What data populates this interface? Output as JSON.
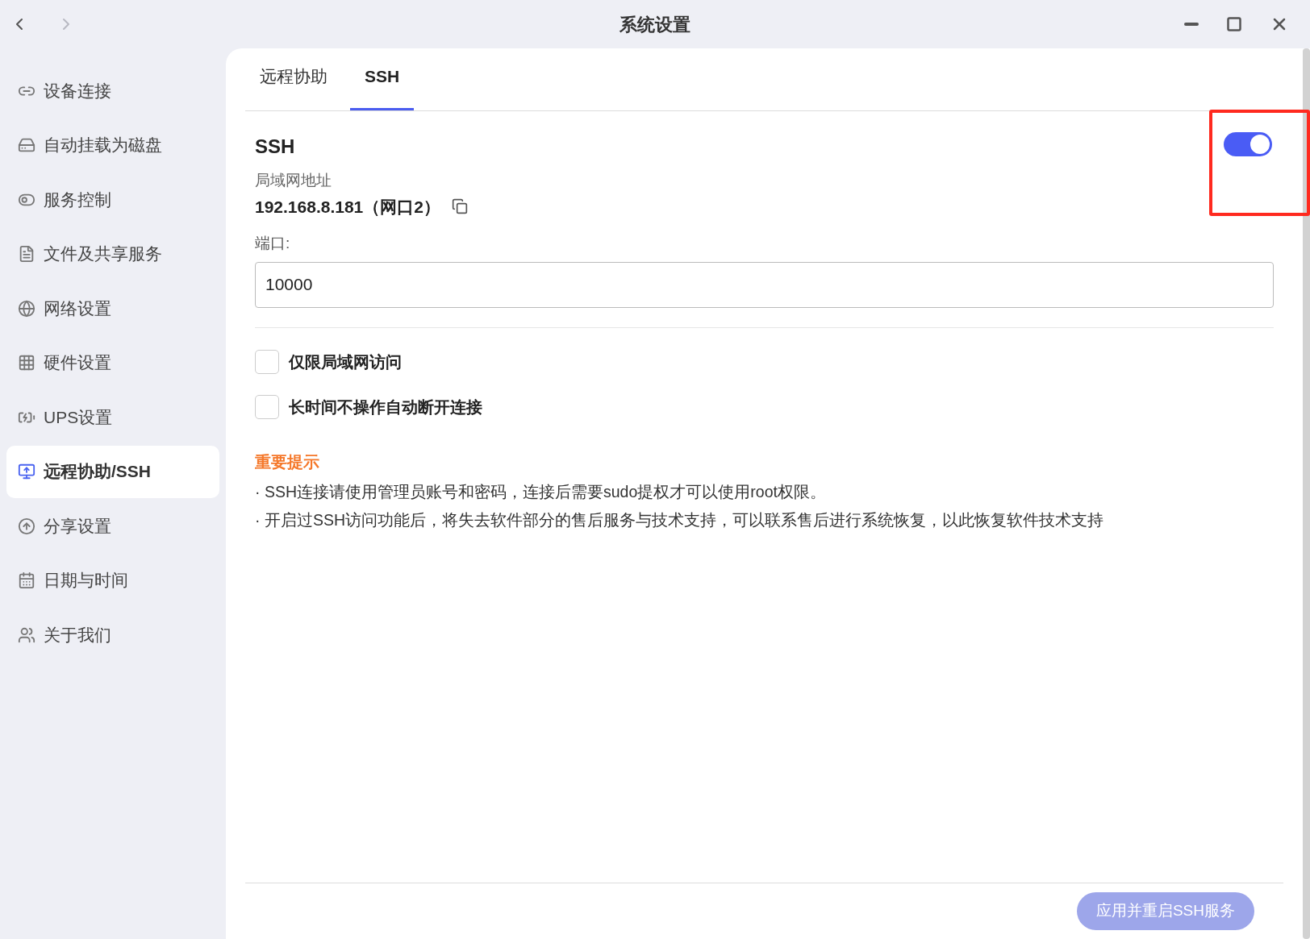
{
  "window": {
    "title": "系统设置",
    "nav": [
      {
        "kind": "back",
        "disabled": false
      },
      {
        "kind": "forward",
        "disabled": true
      }
    ]
  },
  "sidebar": {
    "items": [
      {
        "label": "设备连接",
        "selected": false
      },
      {
        "label": "自动挂载为磁盘",
        "selected": false
      },
      {
        "label": "服务控制",
        "selected": false
      },
      {
        "label": "文件及共享服务",
        "selected": false
      },
      {
        "label": "网络设置",
        "selected": false
      },
      {
        "label": "硬件设置",
        "selected": false
      },
      {
        "label": "UPS设置",
        "selected": false
      },
      {
        "label": "远程协助/SSH",
        "selected": true
      },
      {
        "label": "分享设置",
        "selected": false
      },
      {
        "label": "日期与时间",
        "selected": false
      },
      {
        "label": "关于我们",
        "selected": false
      }
    ]
  },
  "tabs": [
    {
      "label": "远程协助",
      "selected": false
    },
    {
      "label": "SSH",
      "selected": true
    }
  ],
  "ssh": {
    "title": "SSH",
    "on": true,
    "lan_label": "局域网地址",
    "lan_address": "192.168.8.181（网口2）",
    "port_label": "端口:",
    "port_value": "10000",
    "options": [
      {
        "label": "仅限局域网访问",
        "checked": false
      },
      {
        "label": "长时间不操作自动断开连接",
        "checked": false
      }
    ],
    "notice_title": "重要提示",
    "notices": [
      "· SSH连接请使用管理员账号和密码，连接后需要sudo提权才可以使用root权限。",
      "· 开启过SSH访问功能后，将失去软件部分的售后服务与技术支持，可以联系售后进行系统恢复，以此恢复软件技术支持"
    ]
  },
  "footer": {
    "button": {
      "label": "应用并重启SSH服务",
      "disabled": true
    }
  }
}
